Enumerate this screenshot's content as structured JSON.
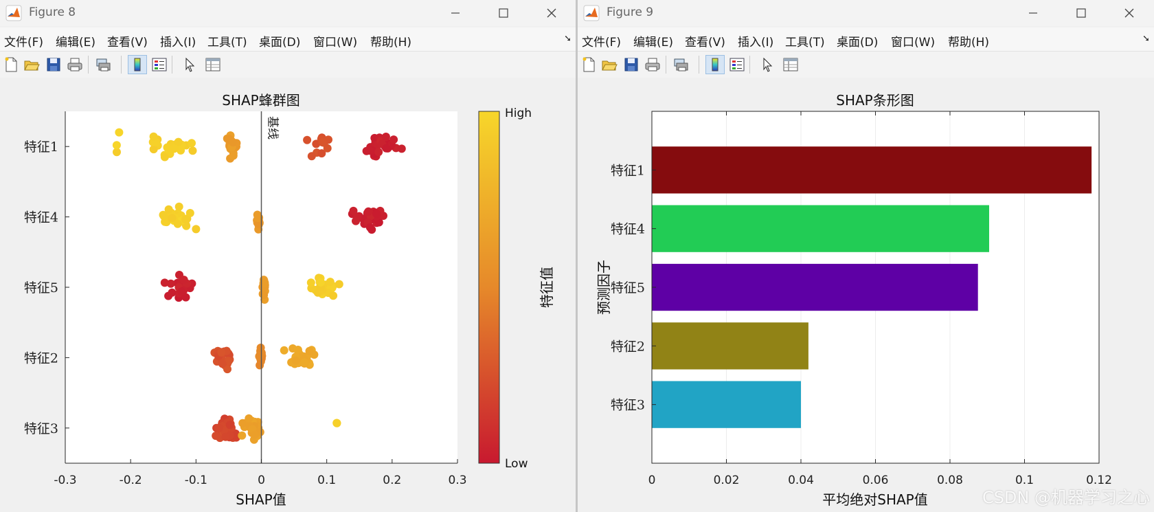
{
  "windows": [
    {
      "title": "Figure 8",
      "menu": [
        "文件(F)",
        "编辑(E)",
        "查看(V)",
        "插入(I)",
        "工具(T)",
        "桌面(D)",
        "窗口(W)",
        "帮助(H)"
      ]
    },
    {
      "title": "Figure 9",
      "menu": [
        "文件(F)",
        "编辑(E)",
        "查看(V)",
        "插入(I)",
        "工具(T)",
        "桌面(D)",
        "窗口(W)",
        "帮助(H)"
      ]
    }
  ],
  "toolbar_icons": [
    "new-file-icon",
    "open-folder-icon",
    "save-icon",
    "print-icon",
    "print-preview-icon",
    "colorbar-icon",
    "legend-icon",
    "pointer-icon",
    "property-inspector-icon"
  ],
  "chart_data": [
    {
      "type": "scatter",
      "subtype": "beeswarm",
      "title": "SHAP蜂群图",
      "xlabel": "SHAP值",
      "ylabel": "",
      "xlim": [
        -0.3,
        0.3
      ],
      "xticks": [
        -0.3,
        -0.2,
        -0.1,
        0,
        0.1,
        0.2,
        0.3
      ],
      "categories": [
        "特征1",
        "特征4",
        "特征5",
        "特征2",
        "特征3"
      ],
      "baseline": {
        "x": 0,
        "label": "基线"
      },
      "colorbar": {
        "label": "特征值",
        "high_label": "High",
        "low_label": "Low",
        "low_color": "#c8192f",
        "mid_color": "#e6892a",
        "high_color": "#f7d62a"
      },
      "colormap_note": "point color = feature value (0=Low red, 1=High yellow)",
      "clusters": [
        {
          "feature": "特征1",
          "center": -0.22,
          "spread": 0.006,
          "n": 3,
          "value": 0.97
        },
        {
          "feature": "特征1",
          "center": -0.135,
          "spread": 0.028,
          "n": 22,
          "value": 0.95
        },
        {
          "feature": "特征1",
          "center": -0.045,
          "spread": 0.008,
          "n": 26,
          "value": 0.62
        },
        {
          "feature": "特征1",
          "center": 0.088,
          "spread": 0.016,
          "n": 12,
          "value": 0.25
        },
        {
          "feature": "特征1",
          "center": 0.18,
          "spread": 0.025,
          "n": 30,
          "value": 0.03
        },
        {
          "feature": "特征4",
          "center": -0.13,
          "spread": 0.022,
          "n": 30,
          "value": 0.96
        },
        {
          "feature": "特征4",
          "center": -0.005,
          "spread": 0.002,
          "n": 12,
          "value": 0.6
        },
        {
          "feature": "特征4",
          "center": 0.165,
          "spread": 0.025,
          "n": 32,
          "value": 0.03
        },
        {
          "feature": "特征5",
          "center": -0.125,
          "spread": 0.02,
          "n": 28,
          "value": 0.03
        },
        {
          "feature": "特征5",
          "center": 0.004,
          "spread": 0.002,
          "n": 14,
          "value": 0.62
        },
        {
          "feature": "特征5",
          "center": 0.098,
          "spread": 0.017,
          "n": 30,
          "value": 0.95
        },
        {
          "feature": "特征2",
          "center": -0.06,
          "spread": 0.013,
          "n": 24,
          "value": 0.25
        },
        {
          "feature": "特征2",
          "center": -0.001,
          "spread": 0.002,
          "n": 14,
          "value": 0.5
        },
        {
          "feature": "特征2",
          "center": 0.06,
          "spread": 0.02,
          "n": 34,
          "value": 0.7
        },
        {
          "feature": "特征3",
          "center": -0.055,
          "spread": 0.015,
          "n": 40,
          "value": 0.2
        },
        {
          "feature": "特征3",
          "center": -0.015,
          "spread": 0.012,
          "n": 28,
          "value": 0.65
        },
        {
          "feature": "特征3",
          "center": 0.115,
          "spread": 0.001,
          "n": 2,
          "value": 0.97
        }
      ]
    },
    {
      "type": "bar",
      "orientation": "horizontal",
      "title": "SHAP条形图",
      "xlabel": "平均绝对SHAP值",
      "ylabel": "预测因子",
      "xlim": [
        0,
        0.12
      ],
      "xticks": [
        0,
        0.02,
        0.04,
        0.06,
        0.08,
        0.1,
        0.12
      ],
      "categories": [
        "特征1",
        "特征4",
        "特征5",
        "特征2",
        "特征3"
      ],
      "values": [
        0.118,
        0.0905,
        0.0875,
        0.042,
        0.04
      ],
      "colors": [
        "#850c0e",
        "#22cc55",
        "#5e00a5",
        "#918316",
        "#21a4c5"
      ],
      "grid": "x"
    }
  ],
  "watermark": "CSDN @机器学习之心"
}
